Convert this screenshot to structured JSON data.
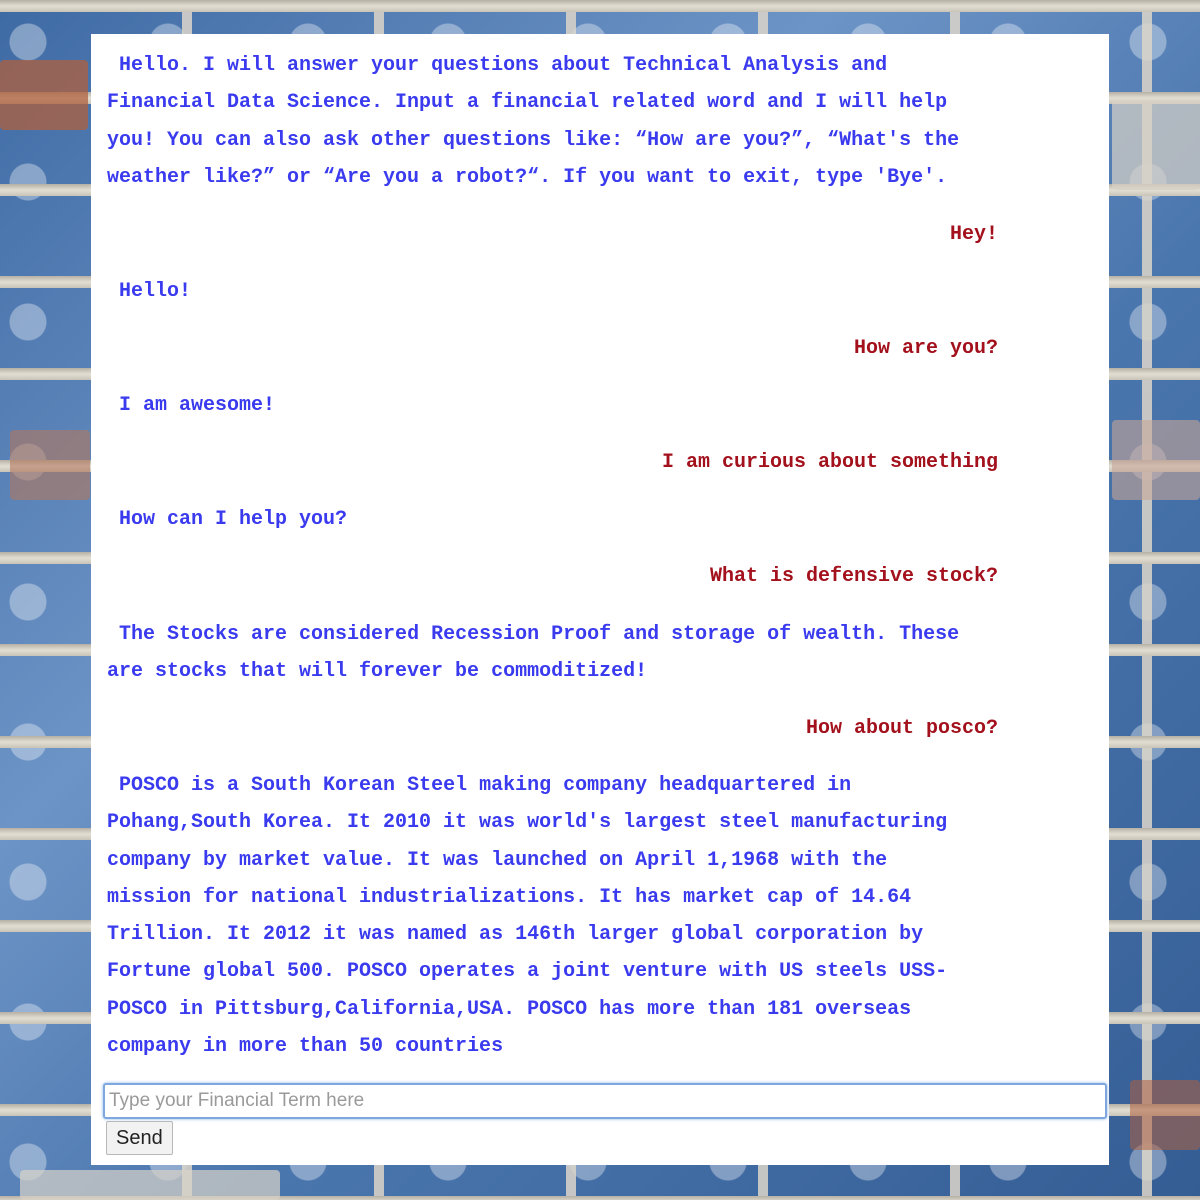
{
  "chat": {
    "messages": [
      {
        "sender": "bot",
        "text": " Hello. I will answer your questions about Technical Analysis and\nFinancial Data Science. Input a financial related word and I will help\nyou! You can also ask other questions like: “How are you?”, “What's the\nweather like?” or “Are you a robot?“. If you want to exit, type 'Bye'."
      },
      {
        "sender": "user",
        "text": "Hey!"
      },
      {
        "sender": "bot",
        "text": " Hello!"
      },
      {
        "sender": "user",
        "text": "How are you?"
      },
      {
        "sender": "bot",
        "text": " I am awesome!"
      },
      {
        "sender": "user",
        "text": "I am curious about something"
      },
      {
        "sender": "bot",
        "text": " How can I help you?"
      },
      {
        "sender": "user",
        "text": "What is defensive stock?"
      },
      {
        "sender": "bot",
        "text": " The Stocks are considered Recession Proof and storage of wealth. These\nare stocks that will forever be commoditized!"
      },
      {
        "sender": "user",
        "text": "How about posco?"
      },
      {
        "sender": "bot",
        "text": " POSCO is a South Korean Steel making company headquartered in\nPohang,South Korea. It 2010 it was world's largest steel manufacturing\ncompany by market value. It was launched on April 1,1968 with the\nmission for national industrializations. It has market cap of 14.64\nTrillion. It 2012 it was named as 146th larger global corporation by\nFortune global 500. POSCO operates a joint venture with US steels USS-\nPOSCO in Pittsburg,California,USA. POSCO has more than 181 overseas\ncompany in more than 50 countries"
      }
    ]
  },
  "input": {
    "placeholder": "Type your Financial Term here",
    "value": ""
  },
  "send_button": {
    "label": "Send"
  },
  "colors": {
    "bot_text": "#3a3aef",
    "user_text": "#a3111d",
    "panel": "#ffffff",
    "wall": "#4f79b0"
  }
}
